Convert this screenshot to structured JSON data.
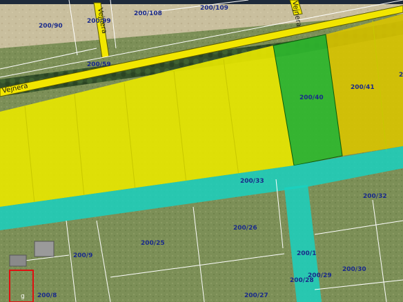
{
  "map": {
    "road_names": {
      "main_road": "Vejnera",
      "side_road_left": "Vejnera",
      "side_road_right": "Vejnera"
    },
    "parcels": [
      {
        "id": "200/90"
      },
      {
        "id": "200/99"
      },
      {
        "id": "200/108"
      },
      {
        "id": "200/109"
      },
      {
        "id": "200/59"
      },
      {
        "id": "200/40"
      },
      {
        "id": "200/41"
      },
      {
        "id": "2"
      },
      {
        "id": "200/33"
      },
      {
        "id": "200/32"
      },
      {
        "id": "200/26"
      },
      {
        "id": "200/25"
      },
      {
        "id": "200/9"
      },
      {
        "id": "200/1"
      },
      {
        "id": "200/30"
      },
      {
        "id": "200/29"
      },
      {
        "id": "200/28"
      },
      {
        "id": "200/27"
      },
      {
        "id": "200/8"
      },
      {
        "id": "g"
      }
    ],
    "colors": {
      "zone_yellow": "#e6e600",
      "zone_yellow_dark": "#d9c400",
      "zone_green": "#2db82d",
      "zone_cyan": "#1ad1c0",
      "road_yellow": "#f2e600",
      "parcel_line": "#ffffff",
      "label_color": "#1a2a8a",
      "highlight_red": "#e01010"
    }
  }
}
